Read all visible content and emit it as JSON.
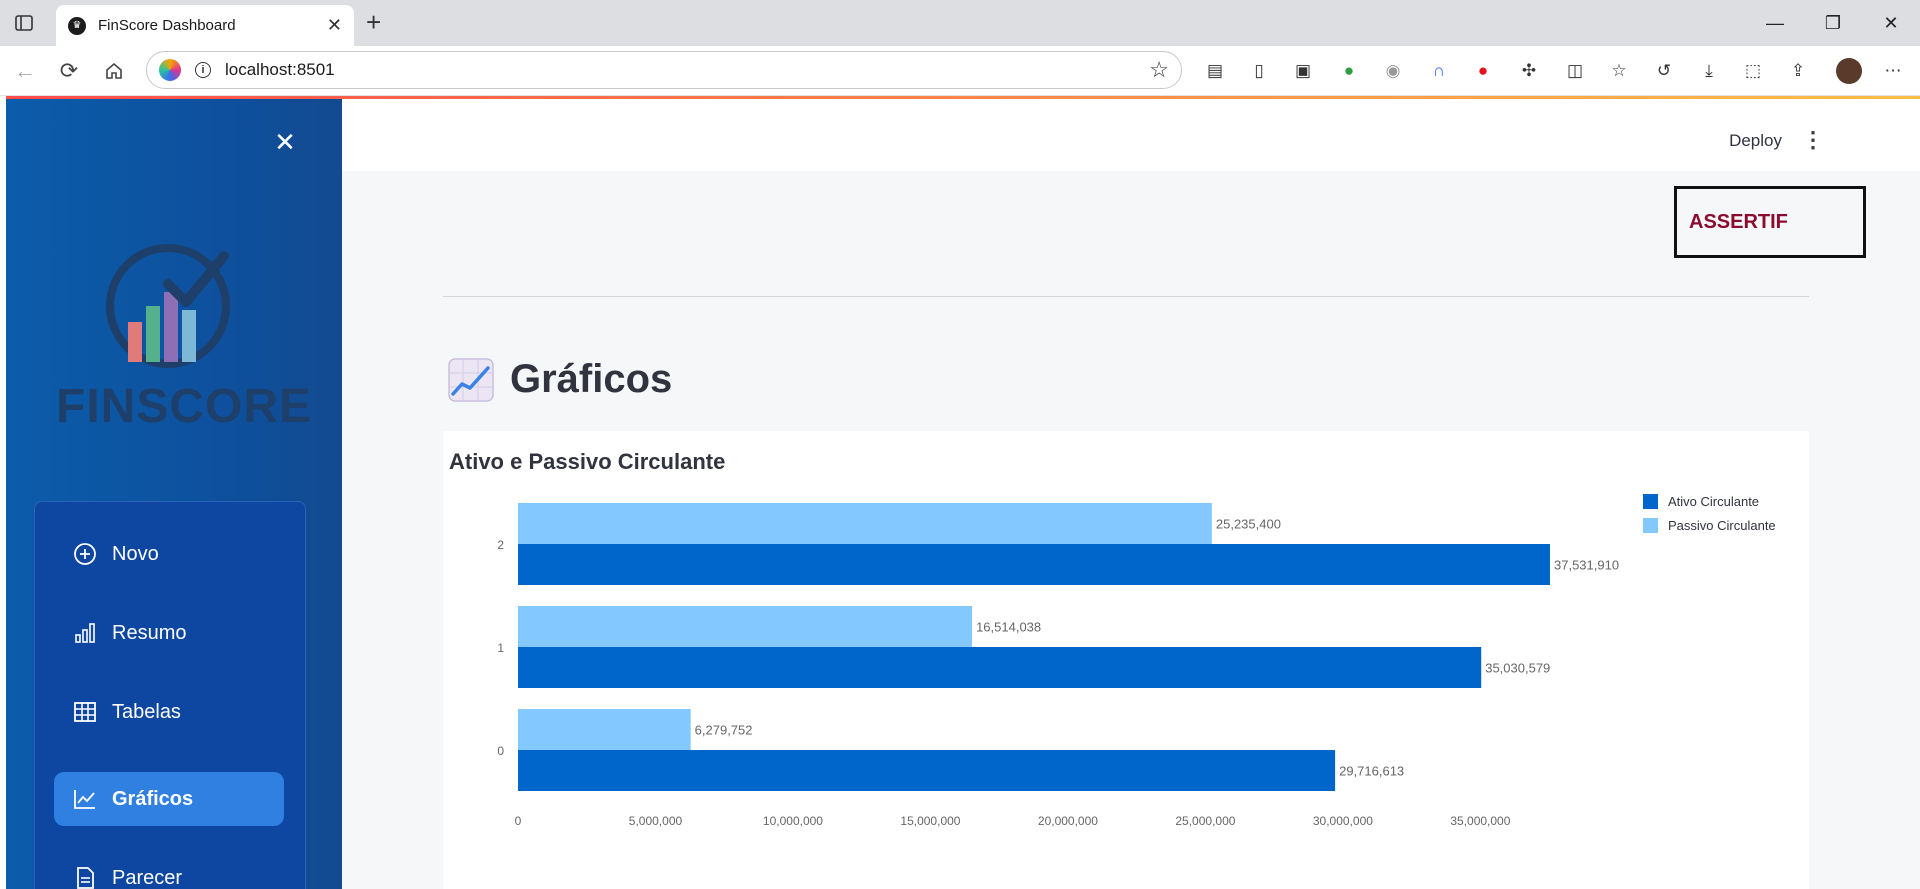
{
  "browser": {
    "tab_title": "FinScore Dashboard",
    "tab_close": "✕",
    "new_tab": "+",
    "url": "localhost:8501",
    "window_controls": [
      "—",
      "❐",
      "✕"
    ]
  },
  "sidebar": {
    "close": "✕",
    "logo_text": "FINSCORE",
    "items": [
      {
        "label": "Novo",
        "icon": "plus-circle-icon"
      },
      {
        "label": "Resumo",
        "icon": "bar-chart-icon"
      },
      {
        "label": "Tabelas",
        "icon": "table-icon"
      },
      {
        "label": "Gráficos",
        "icon": "line-chart-icon",
        "active": true
      },
      {
        "label": "Parecer",
        "icon": "document-icon"
      }
    ]
  },
  "header": {
    "deploy_label": "Deploy",
    "menu_glyph": "⋮"
  },
  "brand_box": "ASSERTIF",
  "page": {
    "title": "Gráficos"
  },
  "chart_data": {
    "type": "bar",
    "orientation": "horizontal",
    "title": "Ativo e Passivo Circulante",
    "categories": [
      "0",
      "1",
      "2"
    ],
    "series": [
      {
        "name": "Ativo Circulante",
        "color": "#0066cc",
        "values": [
          29716613,
          35030579,
          37531910
        ],
        "labels": [
          "29,716,613",
          "35,030,579",
          "37,531,910"
        ]
      },
      {
        "name": "Passivo Circulante",
        "color": "#83c9ff",
        "values": [
          6279752,
          16514038,
          25235400
        ],
        "labels": [
          "6,279,752",
          "16,514,038",
          "25,235,400"
        ]
      }
    ],
    "xlim": [
      0,
      37531910
    ],
    "x_ticks": [
      0,
      5000000,
      10000000,
      15000000,
      20000000,
      25000000,
      30000000,
      35000000
    ],
    "x_tick_labels": [
      "0",
      "5,000,000",
      "10,000,000",
      "15,000,000",
      "20,000,000",
      "25,000,000",
      "30,000,000",
      "35,000,000"
    ],
    "legend": "top-right",
    "grid": false
  }
}
